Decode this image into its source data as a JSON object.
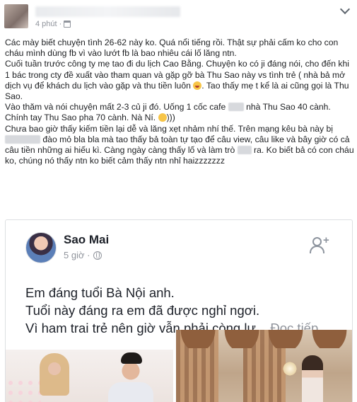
{
  "post": {
    "time": "4 phút",
    "paragraphs": [
      "Các mày biết chuyện tình 26-62 này ko. Quá nổi tiếng rồi. Thật sự phải cấm ko cho con cháu mình dùng fb vì vào lướt fb là bao nhiêu cái lố lăng ntn.",
      "Cuối tuần trước công ty mẹ tao đi du lịch Cao Bằng. Chuyện ko có ji đáng nói, cho đến khi 1 bác trong cty đề xuất vào tham quan và gặp gỡ bà Thu Sao này vs tình trẻ ( nhà bả mở dịch vụ để khách du lịch vào gặp và thu tiền luôn",
      ". Tao thấy mẹ t kể là ai cũng gọi là Thu Sao.",
      "Vào thăm và nói chuyện mất 2-3 củ ji đó. Uống 1 cốc cafe",
      "nhà Thu Sao 40 cành. Chính tay Thu Sao pha 70 cành. Nà Ní.",
      ")))",
      "Chưa bao giờ thấy kiếm tiền lại dễ và lăng xẹt nhảm nhí thế. Trên mạng kêu bà này bị",
      "đào mỏ bla bla mà tao thấy bả toàn tự tạo",
      "để câu view, câu like và bây giờ có cả câu tiền những ai hiếu kì. Càng ngày càng thấy lố và làm trò",
      "ra. Ko biết bả có con cháu ko, chúng nó thấy ntn ko biết cảm thấy ntn nhỉ haizzzzzzz"
    ]
  },
  "shared": {
    "name": "Sao Mai",
    "time": "5 giờ ·",
    "lines": [
      "Em đáng tuổi Bà Nội anh.",
      "Tuổi này đáng ra em đã được nghỉ ngơi.",
      "Vì ham trai trẻ nên giờ vẫn phải còng lư..."
    ],
    "read_more": "Đọc tiếp"
  },
  "icons": {
    "privacy": "calendar-icon",
    "audience": "globe-icon",
    "add_friend": "add-friend-icon",
    "menu": "chevron-down-icon"
  }
}
